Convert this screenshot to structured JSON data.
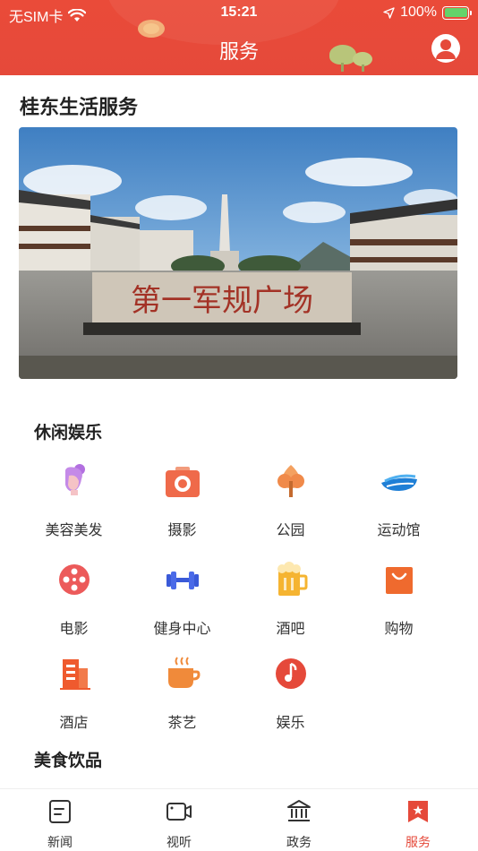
{
  "status_bar": {
    "carrier": "无SIM卡",
    "time": "15:21",
    "battery": "100%"
  },
  "header": {
    "title": "服务"
  },
  "page": {
    "heading": "桂东生活服务"
  },
  "banner": {
    "sign_text": "第一军规广场"
  },
  "sections": {
    "leisure": {
      "title": "休闲娱乐",
      "items": [
        {
          "label": "美容美发",
          "icon": "beauty-icon"
        },
        {
          "label": "摄影",
          "icon": "camera-icon"
        },
        {
          "label": "公园",
          "icon": "park-tree-icon"
        },
        {
          "label": "运动馆",
          "icon": "stadium-icon"
        },
        {
          "label": "电影",
          "icon": "film-reel-icon"
        },
        {
          "label": "健身中心",
          "icon": "dumbbell-icon"
        },
        {
          "label": "酒吧",
          "icon": "beer-icon"
        },
        {
          "label": "购物",
          "icon": "shopping-bag-icon"
        },
        {
          "label": "酒店",
          "icon": "hotel-icon"
        },
        {
          "label": "茶艺",
          "icon": "tea-cup-icon"
        },
        {
          "label": "娱乐",
          "icon": "music-note-icon"
        }
      ]
    },
    "food": {
      "title": "美食饮品"
    }
  },
  "tabbar": {
    "items": [
      {
        "label": "新闻",
        "icon": "news-icon"
      },
      {
        "label": "视听",
        "icon": "video-icon"
      },
      {
        "label": "政务",
        "icon": "government-icon"
      },
      {
        "label": "服务",
        "icon": "service-icon",
        "active": true
      }
    ]
  },
  "colors": {
    "brand": "#e5493a",
    "active_tab": "#e5493a"
  }
}
